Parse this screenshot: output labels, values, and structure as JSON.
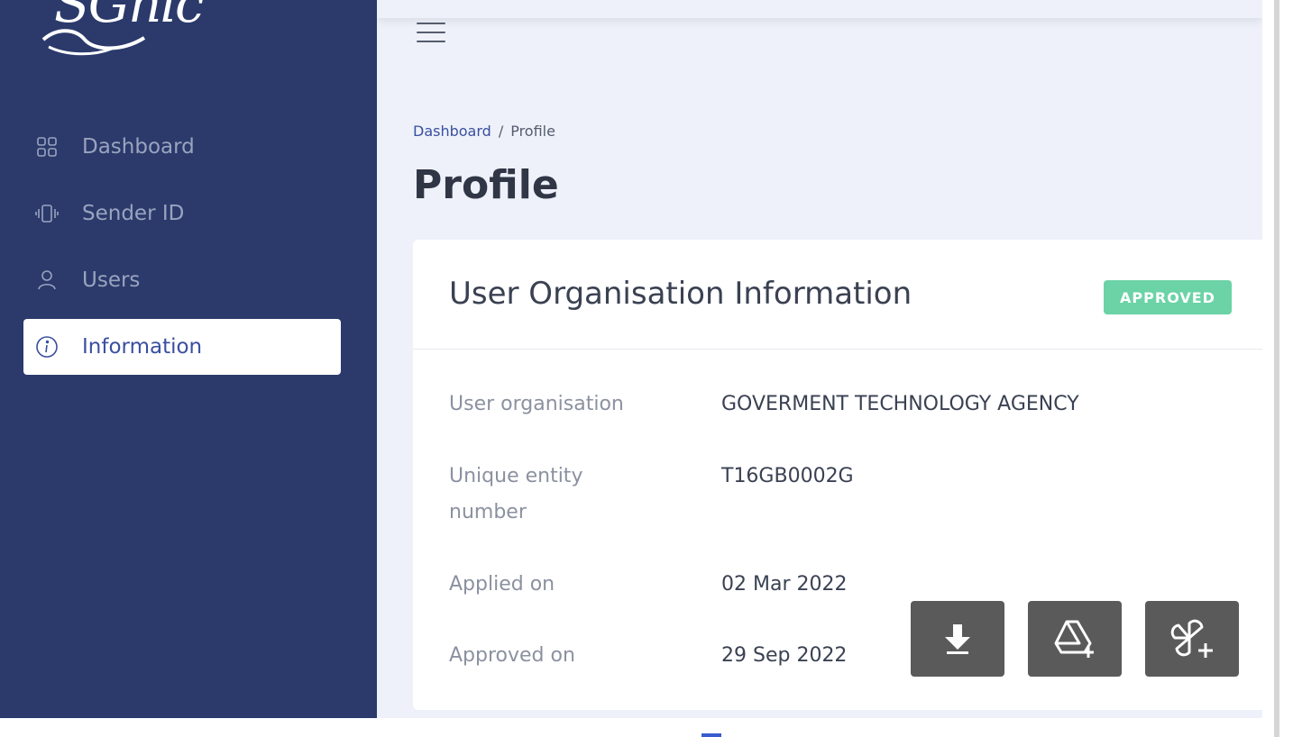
{
  "brand": {
    "logo_text": "SGnic"
  },
  "sidebar": {
    "items": [
      {
        "label": "Dashboard",
        "icon": "grid-icon",
        "active": false
      },
      {
        "label": "Sender ID",
        "icon": "vibrate-phone-icon",
        "active": false
      },
      {
        "label": "Users",
        "icon": "user-icon",
        "active": false
      },
      {
        "label": "Information",
        "icon": "info-circle-icon",
        "active": true
      }
    ]
  },
  "header": {
    "menu_icon": "hamburger-icon"
  },
  "breadcrumb": {
    "parent": "Dashboard",
    "separator": "/",
    "current": "Profile"
  },
  "page": {
    "title": "Profile"
  },
  "card": {
    "title": "User Organisation Information",
    "status": "APPROVED",
    "rows": [
      {
        "label": "User organisation",
        "value": "GOVERMENT TECHNOLOGY AGENCY"
      },
      {
        "label": "Unique entity number",
        "value": "T16GB0002G"
      },
      {
        "label": "Applied on",
        "value": "02 Mar 2022"
      },
      {
        "label": "Approved on",
        "value": "29 Sep 2022"
      }
    ]
  },
  "actions": [
    {
      "icon": "download-icon"
    },
    {
      "icon": "google-drive-add-icon"
    },
    {
      "icon": "pinwheel-add-icon"
    }
  ],
  "colors": {
    "sidebar_bg": "#2b3a6b",
    "main_bg": "#eef1f9",
    "accent": "#3a4fa0",
    "badge_green": "#6bd3a6",
    "fab_grey": "#5a5a5a"
  }
}
